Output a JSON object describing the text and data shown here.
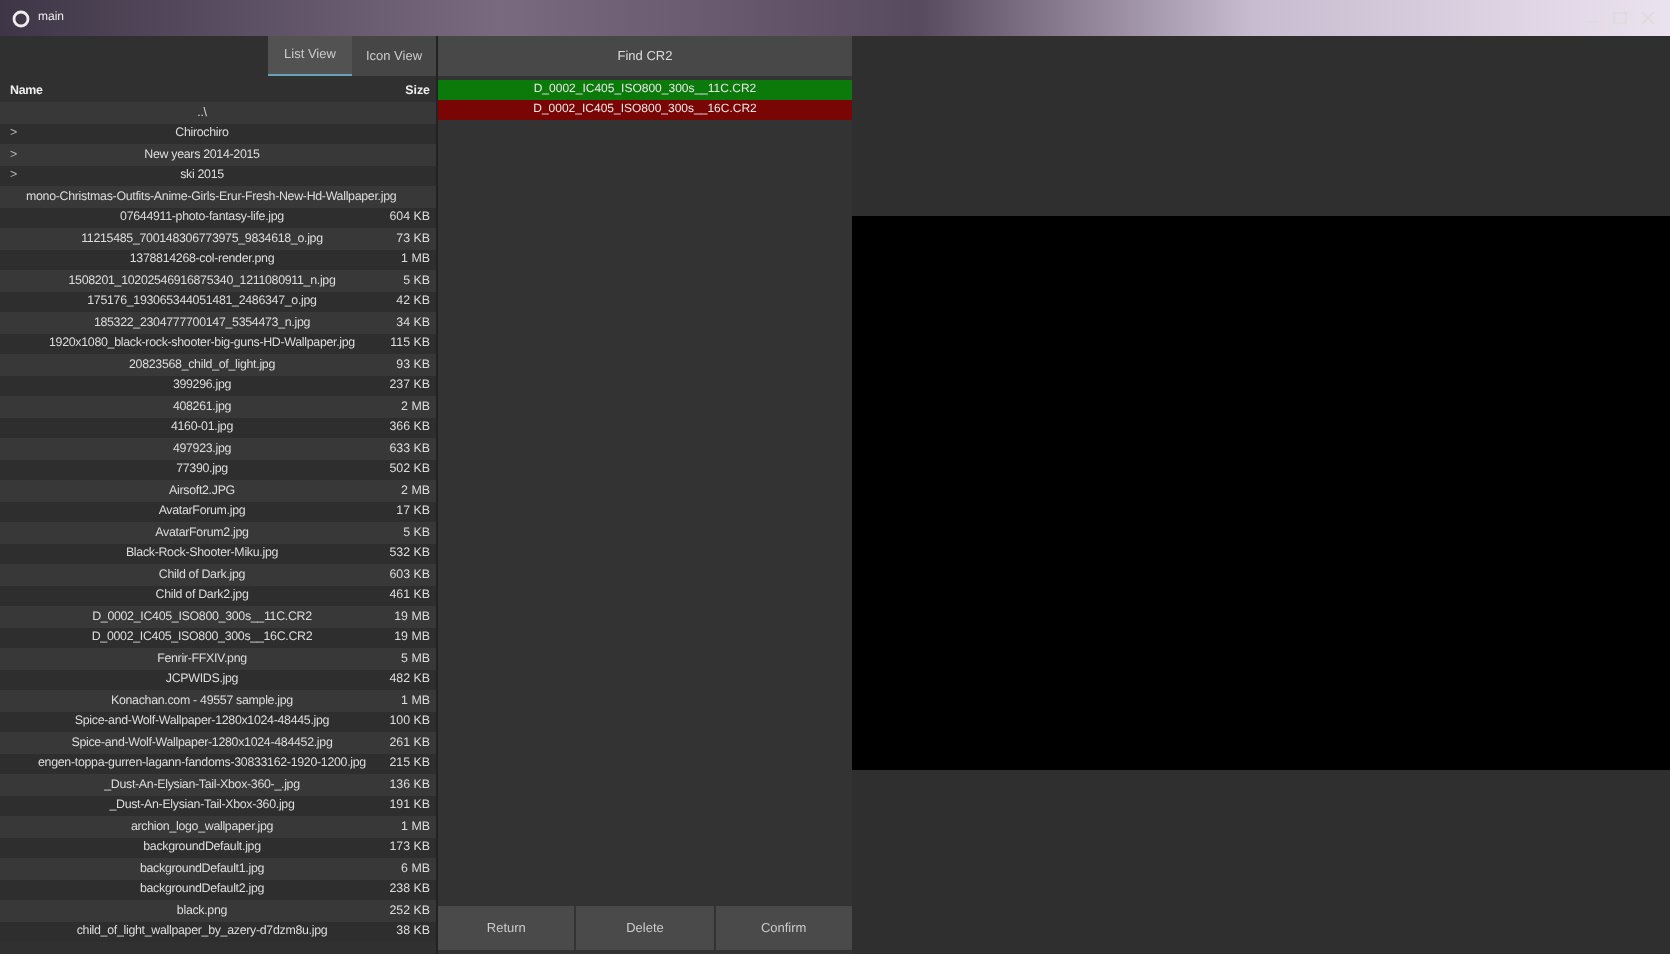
{
  "window": {
    "title": "main"
  },
  "view_tabs": [
    {
      "label": "List View",
      "selected": true
    },
    {
      "label": "Icon View",
      "selected": false
    }
  ],
  "columns": [
    "Name",
    "Size"
  ],
  "files": [
    {
      "kind": "parent",
      "name": "..\\"
    },
    {
      "kind": "folder",
      "name": "Chirochiro",
      "expander": ">"
    },
    {
      "kind": "folder",
      "name": "New years 2014-2015",
      "expander": ">"
    },
    {
      "kind": "folder",
      "name": "ski 2015",
      "expander": ">"
    },
    {
      "kind": "file",
      "name": "mono-Christmas-Outfits-Anime-Girls-Erur-Fresh-New-Hd-Wallpaper.jpg"
    },
    {
      "kind": "file",
      "name": "07644911-photo-fantasy-life.jpg",
      "size": "604 KB"
    },
    {
      "kind": "file",
      "name": "11215485_700148306773975_9834618_o.jpg",
      "size": "73 KB"
    },
    {
      "kind": "file",
      "name": "1378814268-col-render.png",
      "size": "1 MB"
    },
    {
      "kind": "file",
      "name": "1508201_10202546916875340_1211080911_n.jpg",
      "size": "5 KB"
    },
    {
      "kind": "file",
      "name": "175176_193065344051481_2486347_o.jpg",
      "size": "42 KB"
    },
    {
      "kind": "file",
      "name": "185322_2304777700147_5354473_n.jpg",
      "size": "34 KB"
    },
    {
      "kind": "file",
      "name": "1920x1080_black-rock-shooter-big-guns-HD-Wallpaper.jpg",
      "size": "115 KB"
    },
    {
      "kind": "file",
      "name": "20823568_child_of_light.jpg",
      "size": "93 KB"
    },
    {
      "kind": "file",
      "name": "399296.jpg",
      "size": "237 KB"
    },
    {
      "kind": "file",
      "name": "408261.jpg",
      "size": "2 MB"
    },
    {
      "kind": "file",
      "name": "4160-01.jpg",
      "size": "366 KB"
    },
    {
      "kind": "file",
      "name": "497923.jpg",
      "size": "633 KB"
    },
    {
      "kind": "file",
      "name": "77390.jpg",
      "size": "502 KB"
    },
    {
      "kind": "file",
      "name": "Airsoft2.JPG",
      "size": "2 MB"
    },
    {
      "kind": "file",
      "name": "AvatarForum.jpg",
      "size": "17 KB"
    },
    {
      "kind": "file",
      "name": "AvatarForum2.jpg",
      "size": "5 KB"
    },
    {
      "kind": "file",
      "name": "Black-Rock-Shooter-Miku.jpg",
      "size": "532 KB"
    },
    {
      "kind": "file",
      "name": "Child of Dark.jpg",
      "size": "603 KB"
    },
    {
      "kind": "file",
      "name": "Child of Dark2.jpg",
      "size": "461 KB"
    },
    {
      "kind": "file",
      "name": "D_0002_IC405_ISO800_300s__11C.CR2",
      "size": "19 MB"
    },
    {
      "kind": "file",
      "name": "D_0002_IC405_ISO800_300s__16C.CR2",
      "size": "19 MB"
    },
    {
      "kind": "file",
      "name": "Fenrir-FFXIV.png",
      "size": "5 MB"
    },
    {
      "kind": "file",
      "name": "JCPWIDS.jpg",
      "size": "482 KB"
    },
    {
      "kind": "file",
      "name": "Konachan.com - 49557 sample.jpg",
      "size": "1 MB"
    },
    {
      "kind": "file",
      "name": "Spice-and-Wolf-Wallpaper-1280x1024-48445.jpg",
      "size": "100 KB"
    },
    {
      "kind": "file",
      "name": "Spice-and-Wolf-Wallpaper-1280x1024-484452.jpg",
      "size": "261 KB"
    },
    {
      "kind": "file",
      "name": "engen-toppa-gurren-lagann-fandoms-30833162-1920-1200.jpg",
      "size": "215 KB"
    },
    {
      "kind": "file",
      "name": "_Dust-An-Elysian-Tail-Xbox-360-_.jpg",
      "size": "136 KB"
    },
    {
      "kind": "file",
      "name": "_Dust-An-Elysian-Tail-Xbox-360.jpg",
      "size": "191 KB"
    },
    {
      "kind": "file",
      "name": "archion_logo_wallpaper.jpg",
      "size": "1 MB"
    },
    {
      "kind": "file",
      "name": "backgroundDefault.jpg",
      "size": "173 KB"
    },
    {
      "kind": "file",
      "name": "backgroundDefault1.jpg",
      "size": "6 MB"
    },
    {
      "kind": "file",
      "name": "backgroundDefault2.jpg",
      "size": "238 KB"
    },
    {
      "kind": "file",
      "name": "black.png",
      "size": "252 KB"
    },
    {
      "kind": "file",
      "name": "child_of_light_wallpaper_by_azery-d7dzm8u.jpg",
      "size": "38 KB"
    }
  ],
  "find_button": "Find CR2",
  "results": [
    {
      "name": "D_0002_IC405_ISO800_300s__11C.CR2",
      "color": "#0b7a0b"
    },
    {
      "name": "D_0002_IC405_ISO800_300s__16C.CR2",
      "color": "#7a0505"
    }
  ],
  "actions": [
    "Return",
    "Delete",
    "Confirm"
  ]
}
